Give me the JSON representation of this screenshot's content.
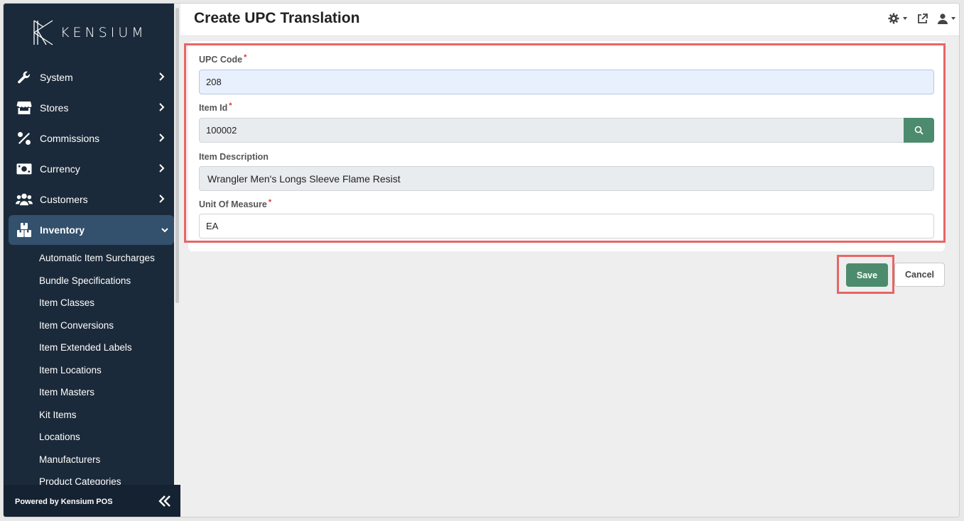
{
  "app": {
    "logo_text": "KENSIUM",
    "footer_text": "Powered by Kensium POS"
  },
  "sidebar": {
    "items": [
      {
        "label": "System",
        "icon": "wrench-icon"
      },
      {
        "label": "Stores",
        "icon": "store-icon"
      },
      {
        "label": "Commissions",
        "icon": "percent-icon"
      },
      {
        "label": "Currency",
        "icon": "money-bill-icon"
      },
      {
        "label": "Customers",
        "icon": "users-icon"
      },
      {
        "label": "Inventory",
        "icon": "boxes-icon",
        "expanded": true
      }
    ],
    "inventory_subitems": [
      "Automatic Item Surcharges",
      "Bundle Specifications",
      "Item Classes",
      "Item Conversions",
      "Item Extended Labels",
      "Item Locations",
      "Item Masters",
      "Kit Items",
      "Locations",
      "Manufacturers",
      "Product Categories"
    ]
  },
  "header": {
    "title": "Create UPC Translation",
    "icons": [
      "settings-icon",
      "external-link-icon",
      "user-icon"
    ]
  },
  "form": {
    "upc_code": {
      "label": "UPC Code",
      "required": "*",
      "value": "208"
    },
    "item_id": {
      "label": "Item Id",
      "required": "*",
      "value": "100002"
    },
    "item_description": {
      "label": "Item Description",
      "value": "Wrangler Men's Longs Sleeve Flame Resist"
    },
    "unit_of_measure": {
      "label": "Unit Of Measure",
      "required": "*",
      "value": "EA"
    }
  },
  "actions": {
    "save_label": "Save",
    "cancel_label": "Cancel"
  },
  "colors": {
    "sidebar_bg": "#1b2a3a",
    "active_item_bg": "#33506d",
    "primary_button": "#4d8b6e",
    "highlight": "#e86565"
  }
}
